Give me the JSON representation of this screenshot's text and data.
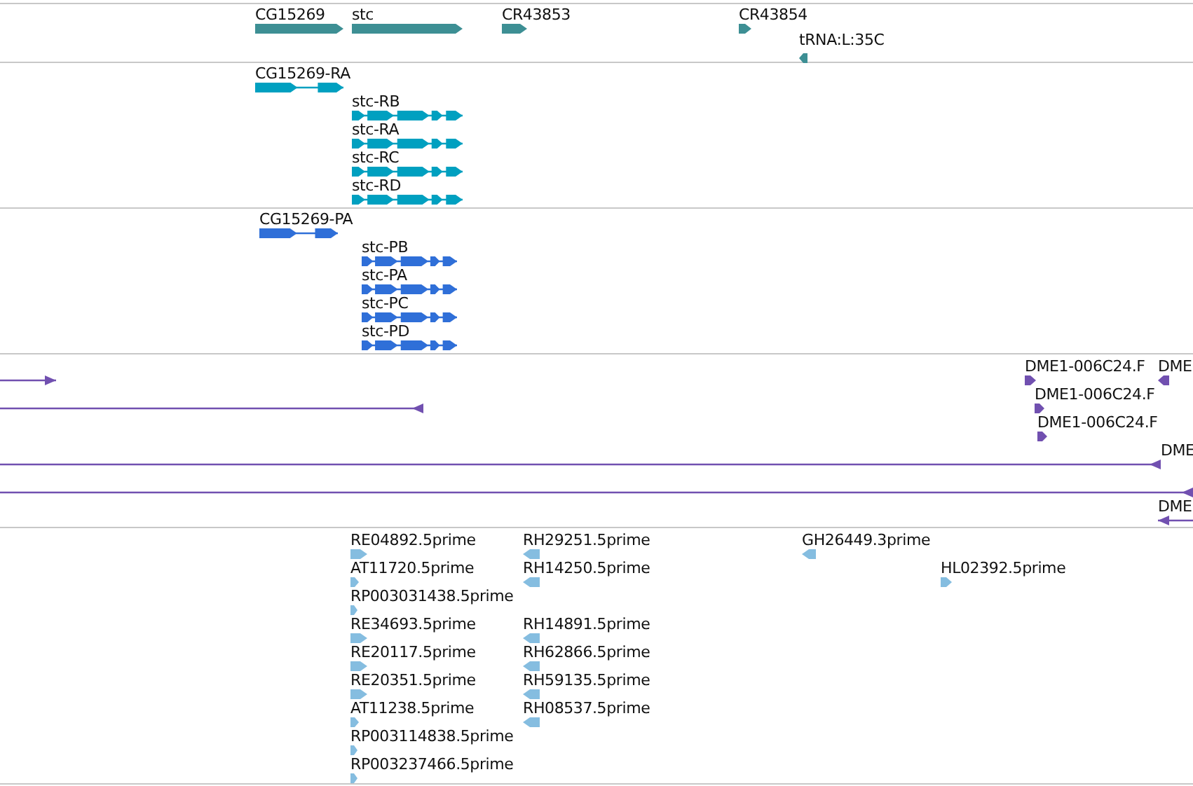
{
  "tracks": [
    {
      "color": "#3d8f94",
      "features": [
        {
          "label": "CG15269",
          "kind": "gene",
          "reverse": false
        },
        {
          "label": "stc",
          "kind": "gene",
          "reverse": false
        },
        {
          "label": "CR43853",
          "kind": "gene",
          "reverse": false
        },
        {
          "label": "CR43854",
          "kind": "gene",
          "reverse": false
        },
        {
          "label": "tRNA:L:35C",
          "kind": "gene",
          "reverse": true
        }
      ]
    },
    {
      "color": "#00a0c0",
      "features": [
        {
          "label": "CG15269-RA",
          "kind": "transcript",
          "reverse": false
        },
        {
          "label": "stc-RB",
          "kind": "transcript",
          "reverse": false
        },
        {
          "label": "stc-RA",
          "kind": "transcript",
          "reverse": false
        },
        {
          "label": "stc-RC",
          "kind": "transcript",
          "reverse": false
        },
        {
          "label": "stc-RD",
          "kind": "transcript",
          "reverse": false
        }
      ]
    },
    {
      "color": "#2f6fd8",
      "features": [
        {
          "label": "CG15269-PA",
          "kind": "transcript",
          "reverse": false
        },
        {
          "label": "stc-PB",
          "kind": "transcript",
          "reverse": false
        },
        {
          "label": "stc-PA",
          "kind": "transcript",
          "reverse": false
        },
        {
          "label": "stc-PC",
          "kind": "transcript",
          "reverse": false
        },
        {
          "label": "stc-PD",
          "kind": "transcript",
          "reverse": false
        }
      ]
    },
    {
      "color": "#7150b0",
      "features": [
        {
          "kind": "match",
          "reverse": false
        },
        {
          "label": "DME1-006C24.F",
          "kind": "gene",
          "reverse": false
        },
        {
          "label": "DME",
          "kind": "gene",
          "reverse": true
        },
        {
          "kind": "match",
          "reverse": true
        },
        {
          "label": "DME1-006C24.F",
          "kind": "gene",
          "reverse": false
        },
        {
          "label": "DME1-006C24.F",
          "kind": "gene",
          "reverse": false
        },
        {
          "kind": "match",
          "reverse": true
        },
        {
          "label": "DME",
          "kind": "label"
        },
        {
          "kind": "match",
          "reverse": true
        },
        {
          "label": "DME",
          "kind": "match",
          "reverse": true
        }
      ]
    },
    {
      "color": "#85bde0",
      "features": [
        {
          "label": "RE04892.5prime",
          "kind": "gene",
          "reverse": false
        },
        {
          "label": "RH29251.5prime",
          "kind": "gene",
          "reverse": true
        },
        {
          "label": "GH26449.3prime",
          "kind": "gene",
          "reverse": true
        },
        {
          "label": "AT11720.5prime",
          "kind": "gene",
          "reverse": false
        },
        {
          "label": "RH14250.5prime",
          "kind": "gene",
          "reverse": true
        },
        {
          "label": "HL02392.5prime",
          "kind": "gene",
          "reverse": false
        },
        {
          "label": "RP003031438.5prime",
          "kind": "gene",
          "reverse": false
        },
        {
          "label": "RE34693.5prime",
          "kind": "gene",
          "reverse": false
        },
        {
          "label": "RH14891.5prime",
          "kind": "gene",
          "reverse": true
        },
        {
          "label": "RE20117.5prime",
          "kind": "gene",
          "reverse": false
        },
        {
          "label": "RH62866.5prime",
          "kind": "gene",
          "reverse": true
        },
        {
          "label": "RE20351.5prime",
          "kind": "gene",
          "reverse": false
        },
        {
          "label": "RH59135.5prime",
          "kind": "gene",
          "reverse": true
        },
        {
          "label": "AT11238.5prime",
          "kind": "gene",
          "reverse": false
        },
        {
          "label": "RH08537.5prime",
          "kind": "gene",
          "reverse": true
        },
        {
          "label": "RP003114838.5prime",
          "kind": "gene",
          "reverse": false
        },
        {
          "label": "RP003237466.5prime",
          "kind": "gene",
          "reverse": false
        }
      ]
    }
  ]
}
